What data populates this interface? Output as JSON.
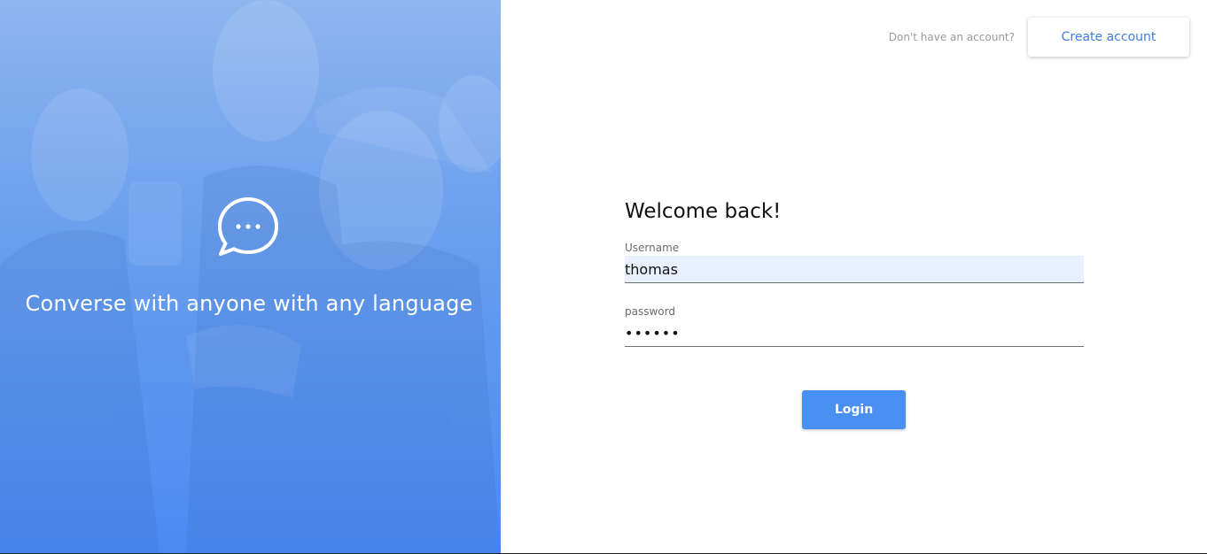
{
  "hero": {
    "icon": "chat-bubble-ellipsis-icon",
    "tagline": "Converse with anyone with any language"
  },
  "header": {
    "prompt": "Don't have an account?",
    "create_account_label": "Create account"
  },
  "form": {
    "title": "Welcome back!",
    "username": {
      "label": "Username",
      "value": "thomas"
    },
    "password": {
      "label": "password",
      "value": "••••••"
    },
    "login_label": "Login"
  },
  "colors": {
    "accent": "#4a8ff2",
    "link": "#3d7ee0",
    "autofill_bg": "#e8f0fe"
  }
}
